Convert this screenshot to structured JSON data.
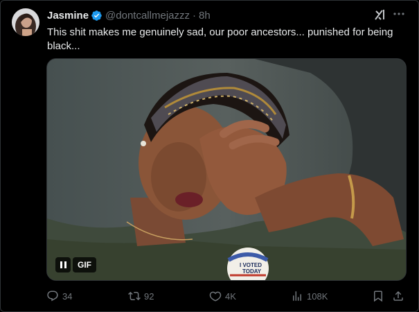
{
  "tweet": {
    "author_name": "Jasmine",
    "handle": "@dontcallmejazzz",
    "separator": "·",
    "time": "8h",
    "text": "This shit makes me genuinely sad, our poor ancestors... punished for being black...",
    "media": {
      "type": "gif",
      "badge_label": "GIF",
      "sticker_text_line1": "I VOTED",
      "sticker_text_line2": "TODAY"
    }
  },
  "actions": {
    "replies": "34",
    "reposts": "92",
    "likes": "4K",
    "views": "108K"
  },
  "icons": {
    "verified": "verified-badge-icon",
    "grok": "grok-icon",
    "more": "more-icon",
    "reply": "reply-icon",
    "repost": "repost-icon",
    "like": "heart-icon",
    "views": "views-icon",
    "bookmark": "bookmark-icon",
    "share": "share-icon"
  },
  "colors": {
    "background": "#000000",
    "text_primary": "#e7e9ea",
    "text_secondary": "#71767b",
    "verified_blue": "#1d9bf0",
    "border": "#2f3336"
  }
}
